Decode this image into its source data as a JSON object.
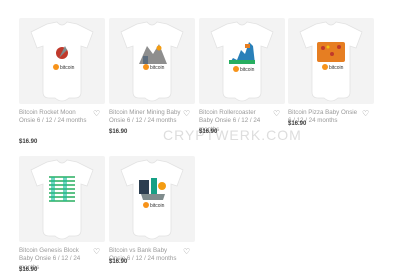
{
  "watermark": "CRYPTWERK.COM",
  "products": [
    {
      "title": "Bitcoin Rocket Moon Onsie 6 / 12 / 24 months",
      "price": "$16.90",
      "art": "rocket",
      "art_colors": [
        "#f7931a",
        "#c0392b",
        "#7f8c8d"
      ]
    },
    {
      "title": "Bitcoin Miner Mining Baby Onsie 6 / 12 / 24 months",
      "price": "$16.90",
      "art": "miner",
      "art_colors": [
        "#8e8e8e",
        "#f39c12",
        "#5d6d7e"
      ]
    },
    {
      "title": "Bitcoin Rollercoaster Baby Onsie 6 / 12 / 24 months",
      "price": "$16.90",
      "art": "rollercoaster",
      "art_colors": [
        "#2980b9",
        "#27ae60",
        "#e67e22"
      ]
    },
    {
      "title": "Bitcoin Pizza Baby Onsie 6 / 12 / 24 months",
      "price": "$16.90",
      "art": "pizza",
      "art_colors": [
        "#e67e22",
        "#c0392b",
        "#f1c40f"
      ]
    },
    {
      "title": "Bitcoin Genesis Block Baby Onsie 6 / 12 / 24 months",
      "price": "$16.90",
      "art": "genesis",
      "art_colors": [
        "#27ae60",
        "#1abc9c"
      ]
    },
    {
      "title": "Bitcoin vs Bank Baby Onsie 6 / 12 / 24 months",
      "price": "$16.90",
      "art": "bank",
      "art_colors": [
        "#2c3e50",
        "#f39c12",
        "#16a085"
      ]
    }
  ],
  "logo_text": "bitcoin",
  "icons": {
    "wishlist": "heart-outline-icon"
  }
}
